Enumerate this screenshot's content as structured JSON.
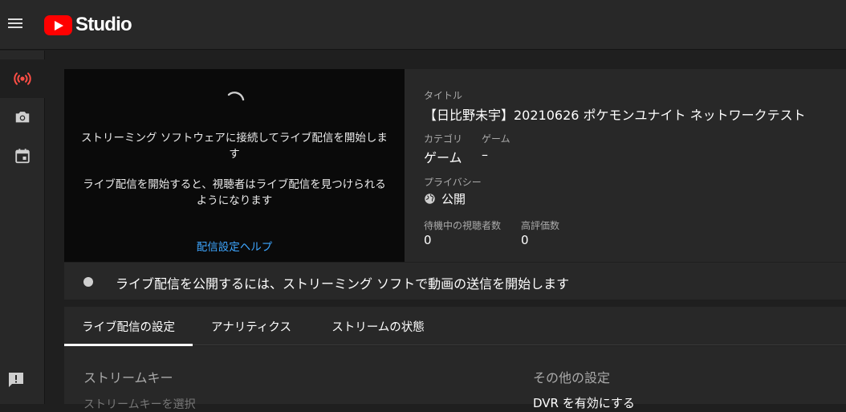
{
  "app": {
    "logo_text": "Studio"
  },
  "nav": {
    "items": [
      {
        "icon": "live-icon",
        "active": true
      },
      {
        "icon": "camera-icon",
        "active": false
      },
      {
        "icon": "calendar-icon",
        "active": false
      }
    ],
    "feedback_icon": "feedback-icon"
  },
  "preview": {
    "message1": "ストリーミング ソフトウェアに接続してライブ配信を開始します",
    "message2": "ライブ配信を開始すると、視聴者はライブ配信を見つけられるようになります",
    "help_link": "配信設定ヘルプ"
  },
  "info": {
    "title_label": "タイトル",
    "title_value": "【日比野未宇】20210626 ポケモンユナイト ネットワークテスト",
    "category_label": "カテゴリ",
    "category_value": "ゲーム",
    "game_label": "ゲーム",
    "game_value": "–",
    "privacy_label": "プライバシー",
    "privacy_value": "公開",
    "waiting_label": "待機中の視聴者数",
    "waiting_value": "0",
    "likes_label": "高評価数",
    "likes_value": "0"
  },
  "status": {
    "text": "ライブ配信を公開するには、ストリーミング ソフトで動画の送信を開始します"
  },
  "tabs": [
    {
      "label": "ライブ配信の設定",
      "active": true
    },
    {
      "label": "アナリティクス",
      "active": false
    },
    {
      "label": "ストリームの状態",
      "active": false
    }
  ],
  "settings": {
    "stream_key_heading": "ストリームキー",
    "stream_key_select": "ストリームキーを選択",
    "other_heading": "その他の設定",
    "dvr_label": "DVR を有効にする"
  },
  "colors": {
    "accent_red": "#ff0000",
    "link_blue": "#3ea6ff",
    "live_icon": "#ff4e45"
  }
}
